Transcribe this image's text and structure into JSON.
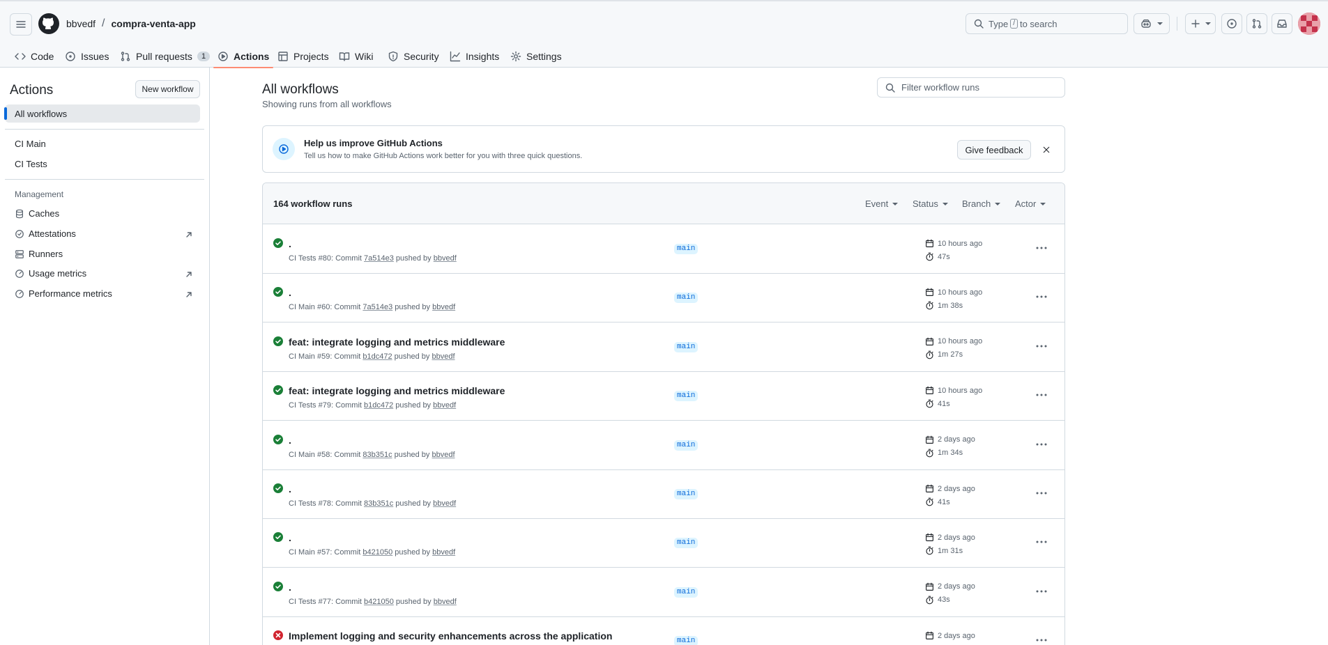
{
  "header": {
    "owner": "bbvedf",
    "separator": "/",
    "repo": "compra-venta-app",
    "search_prefix": "Type",
    "search_key": "/",
    "search_suffix": "to search"
  },
  "nav": {
    "tabs": [
      {
        "label": "Code",
        "icon": "code-icon"
      },
      {
        "label": "Issues",
        "icon": "issue-icon"
      },
      {
        "label": "Pull requests",
        "icon": "pull-request-icon",
        "count": "1"
      },
      {
        "label": "Actions",
        "icon": "play-icon",
        "selected": true
      },
      {
        "label": "Projects",
        "icon": "table-icon"
      },
      {
        "label": "Wiki",
        "icon": "book-icon"
      },
      {
        "label": "Security",
        "icon": "shield-icon"
      },
      {
        "label": "Insights",
        "icon": "graph-icon"
      },
      {
        "label": "Settings",
        "icon": "gear-icon"
      }
    ]
  },
  "sidebar": {
    "title": "Actions",
    "new_workflow": "New workflow",
    "all_workflows": "All workflows",
    "workflows": [
      "CI Main",
      "CI Tests"
    ],
    "management_heading": "Management",
    "management": [
      {
        "label": "Caches",
        "icon": "database-icon"
      },
      {
        "label": "Attestations",
        "icon": "verified-icon",
        "external": true
      },
      {
        "label": "Runners",
        "icon": "server-icon"
      },
      {
        "label": "Usage metrics",
        "icon": "meter-icon",
        "external": true
      },
      {
        "label": "Performance metrics",
        "icon": "meter-icon",
        "external": true
      }
    ]
  },
  "main": {
    "title": "All workflows",
    "subtitle": "Showing runs from all workflows",
    "filter_placeholder": "Filter workflow runs",
    "banner": {
      "title": "Help us improve GitHub Actions",
      "description": "Tell us how to make GitHub Actions work better for you with three quick questions.",
      "button": "Give feedback"
    },
    "runs_count": "164 workflow runs",
    "filters": [
      "Event",
      "Status",
      "Branch",
      "Actor"
    ],
    "runs": [
      {
        "status": "success",
        "title": ".",
        "workflow": "CI Tests #80",
        "commit": "7a514e3",
        "actor": "bbvedf",
        "branch": "main",
        "date": "10 hours ago",
        "duration": "47s"
      },
      {
        "status": "success",
        "title": ".",
        "workflow": "CI Main #60",
        "commit": "7a514e3",
        "actor": "bbvedf",
        "branch": "main",
        "date": "10 hours ago",
        "duration": "1m 38s"
      },
      {
        "status": "success",
        "title": "feat: integrate logging and metrics middleware",
        "workflow": "CI Main #59",
        "commit": "b1dc472",
        "actor": "bbvedf",
        "branch": "main",
        "date": "10 hours ago",
        "duration": "1m 27s"
      },
      {
        "status": "success",
        "title": "feat: integrate logging and metrics middleware",
        "workflow": "CI Tests #79",
        "commit": "b1dc472",
        "actor": "bbvedf",
        "branch": "main",
        "date": "10 hours ago",
        "duration": "41s"
      },
      {
        "status": "success",
        "title": ".",
        "workflow": "CI Main #58",
        "commit": "83b351c",
        "actor": "bbvedf",
        "branch": "main",
        "date": "2 days ago",
        "duration": "1m 34s"
      },
      {
        "status": "success",
        "title": ".",
        "workflow": "CI Tests #78",
        "commit": "83b351c",
        "actor": "bbvedf",
        "branch": "main",
        "date": "2 days ago",
        "duration": "41s"
      },
      {
        "status": "success",
        "title": ".",
        "workflow": "CI Main #57",
        "commit": "b421050",
        "actor": "bbvedf",
        "branch": "main",
        "date": "2 days ago",
        "duration": "1m 31s"
      },
      {
        "status": "success",
        "title": ".",
        "workflow": "CI Tests #77",
        "commit": "b421050",
        "actor": "bbvedf",
        "branch": "main",
        "date": "2 days ago",
        "duration": "43s"
      },
      {
        "status": "failure",
        "title": "Implement logging and security enhancements across the application",
        "workflow": "",
        "commit": "",
        "actor": "",
        "branch": "main",
        "date": "2 days ago",
        "duration": ""
      }
    ],
    "run_meta": {
      "commit_word": ": Commit",
      "pushed_by": "pushed by"
    }
  },
  "colors": {
    "success": "#1a7f37",
    "failure": "#d1242f",
    "accent": "#0969da",
    "tab_underline": "#fd8c73"
  }
}
